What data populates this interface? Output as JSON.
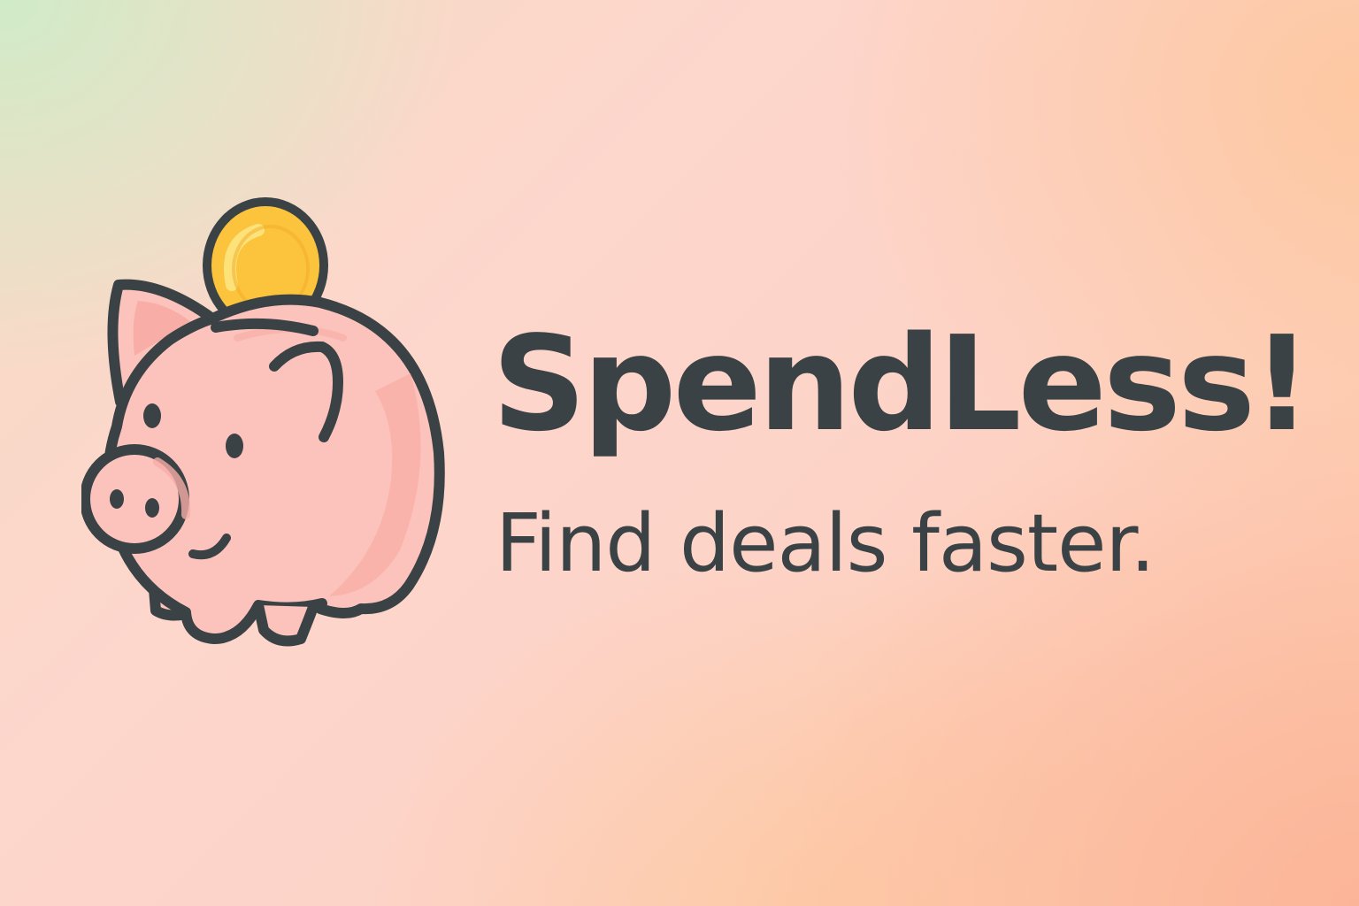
{
  "brand": {
    "name": "SpendLess!",
    "tagline": "Find deals faster."
  },
  "logo": {
    "icon": "piggy-bank-with-coin",
    "colors": {
      "pig_fill": "#fcc3bd",
      "pig_shade": "#f8aea6",
      "outline": "#3b4245",
      "coin_fill": "#fcc43c",
      "coin_highlight": "#fde27a"
    }
  },
  "colors": {
    "text": "#3b4245",
    "background_start": "#cfecc8",
    "background_mid": "#fdd6cc",
    "background_end": "#fcb296"
  }
}
